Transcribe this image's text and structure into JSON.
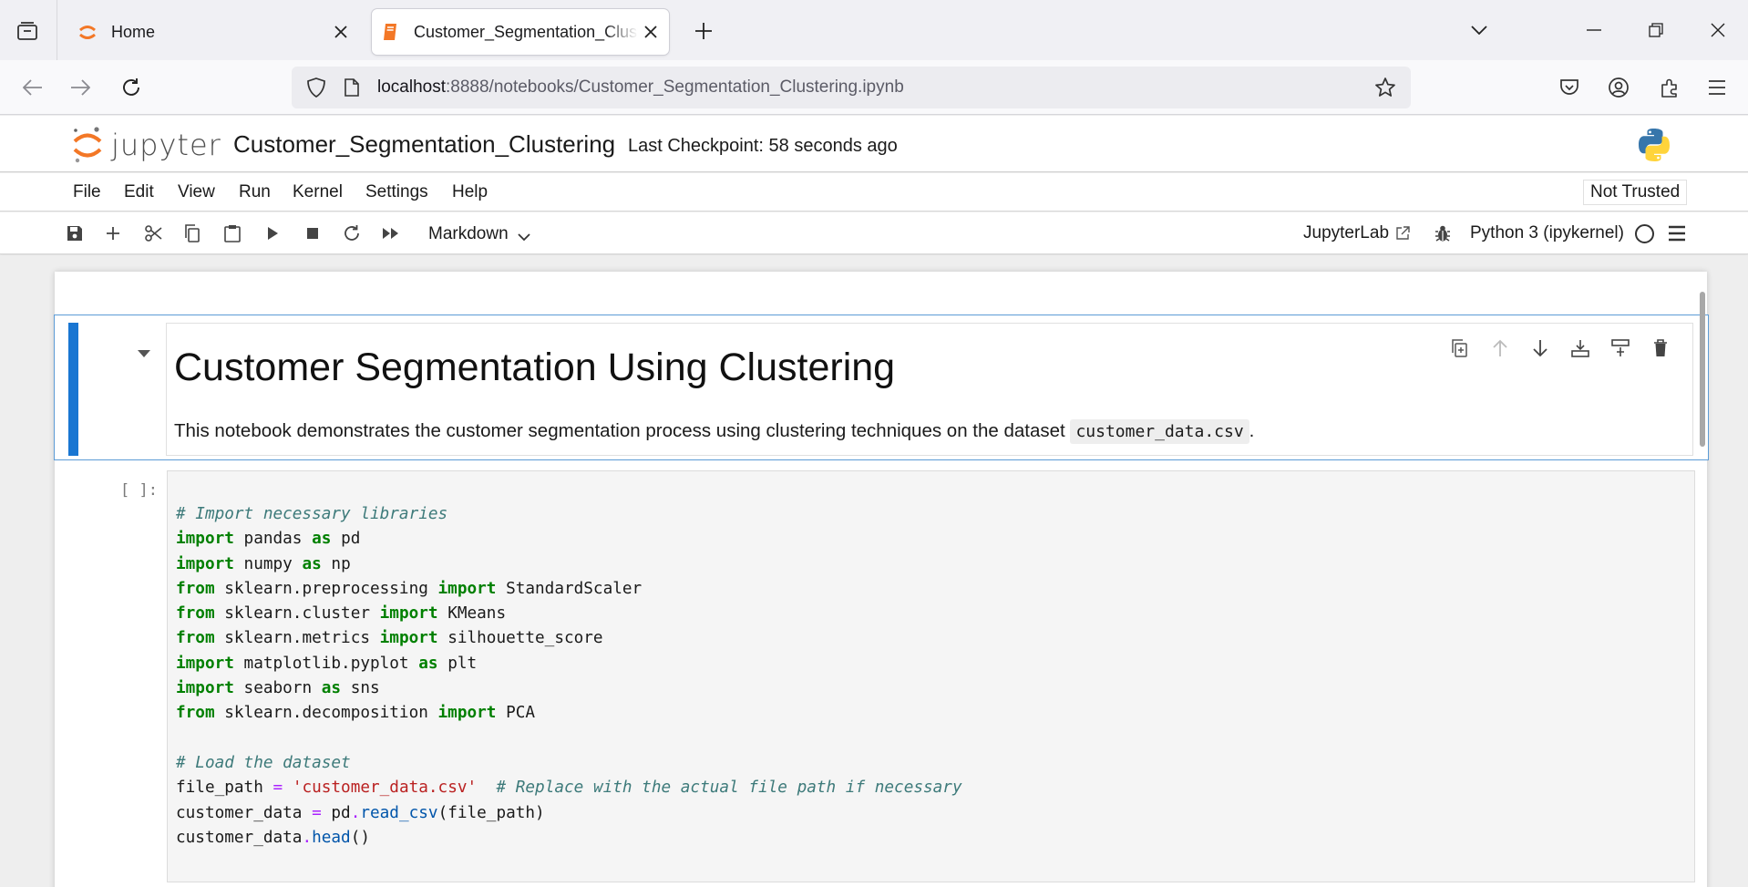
{
  "browser": {
    "tabs": [
      {
        "title": "Home",
        "favicon": "jupyter-favicon-icon"
      },
      {
        "title": "Customer_Segmentation_Clustering.ipynb",
        "favicon": "notebook-favicon-icon",
        "active": true
      }
    ],
    "url_host": "localhost",
    "url_rest": ":8888/notebooks/Customer_Segmentation_Clustering.ipynb"
  },
  "jupyter": {
    "logo_text": "jupyter",
    "notebook_name": "Customer_Segmentation_Clustering",
    "checkpoint": "Last Checkpoint: 58 seconds ago",
    "menu": [
      "File",
      "Edit",
      "View",
      "Run",
      "Kernel",
      "Settings",
      "Help"
    ],
    "trust_label": "Not Trusted",
    "cell_type": "Markdown",
    "jupyterlab_label": "JupyterLab",
    "kernel_name": "Python 3 (ipykernel)"
  },
  "cells": {
    "markdown": {
      "heading": "Customer Segmentation Using Clustering",
      "paragraph_before": "This notebook demonstrates the customer segmentation process using clustering techniques on the dataset ",
      "paragraph_code": "customer_data.csv",
      "paragraph_after": "."
    },
    "code": {
      "prompt": "[ ]:",
      "lines": [
        [
          {
            "t": "c",
            "v": "# Import necessary libraries"
          }
        ],
        [
          {
            "t": "k",
            "v": "import"
          },
          {
            "t": "",
            "v": " pandas "
          },
          {
            "t": "k",
            "v": "as"
          },
          {
            "t": "",
            "v": " pd"
          }
        ],
        [
          {
            "t": "k",
            "v": "import"
          },
          {
            "t": "",
            "v": " numpy "
          },
          {
            "t": "k",
            "v": "as"
          },
          {
            "t": "",
            "v": " np"
          }
        ],
        [
          {
            "t": "k",
            "v": "from"
          },
          {
            "t": "",
            "v": " sklearn.preprocessing "
          },
          {
            "t": "k",
            "v": "import"
          },
          {
            "t": "",
            "v": " StandardScaler"
          }
        ],
        [
          {
            "t": "k",
            "v": "from"
          },
          {
            "t": "",
            "v": " sklearn.cluster "
          },
          {
            "t": "k",
            "v": "import"
          },
          {
            "t": "",
            "v": " KMeans"
          }
        ],
        [
          {
            "t": "k",
            "v": "from"
          },
          {
            "t": "",
            "v": " sklearn.metrics "
          },
          {
            "t": "k",
            "v": "import"
          },
          {
            "t": "",
            "v": " silhouette_score"
          }
        ],
        [
          {
            "t": "k",
            "v": "import"
          },
          {
            "t": "",
            "v": " matplotlib.pyplot "
          },
          {
            "t": "k",
            "v": "as"
          },
          {
            "t": "",
            "v": " plt"
          }
        ],
        [
          {
            "t": "k",
            "v": "import"
          },
          {
            "t": "",
            "v": " seaborn "
          },
          {
            "t": "k",
            "v": "as"
          },
          {
            "t": "",
            "v": " sns"
          }
        ],
        [
          {
            "t": "k",
            "v": "from"
          },
          {
            "t": "",
            "v": " sklearn.decomposition "
          },
          {
            "t": "k",
            "v": "import"
          },
          {
            "t": "",
            "v": " PCA"
          }
        ],
        [],
        [
          {
            "t": "c",
            "v": "# Load the dataset"
          }
        ],
        [
          {
            "t": "",
            "v": "file_path "
          },
          {
            "t": "o",
            "v": "="
          },
          {
            "t": "",
            "v": " "
          },
          {
            "t": "s",
            "v": "'customer_data.csv'"
          },
          {
            "t": "",
            "v": "  "
          },
          {
            "t": "c",
            "v": "# Replace with the actual file path if necessary"
          }
        ],
        [
          {
            "t": "",
            "v": "customer_data "
          },
          {
            "t": "o",
            "v": "="
          },
          {
            "t": "",
            "v": " pd"
          },
          {
            "t": "o",
            "v": "."
          },
          {
            "t": "f",
            "v": "read_csv"
          },
          {
            "t": "",
            "v": "(file_path)"
          }
        ],
        [
          {
            "t": "",
            "v": "customer_data"
          },
          {
            "t": "o",
            "v": "."
          },
          {
            "t": "f",
            "v": "head"
          },
          {
            "t": "",
            "v": "()"
          }
        ]
      ]
    }
  },
  "colors": {
    "accent_blue": "#1976d2",
    "jupyter_orange": "#f37726",
    "keyword_green": "#008000",
    "comment_teal": "#3d7a7a",
    "string_red": "#ba2121"
  }
}
